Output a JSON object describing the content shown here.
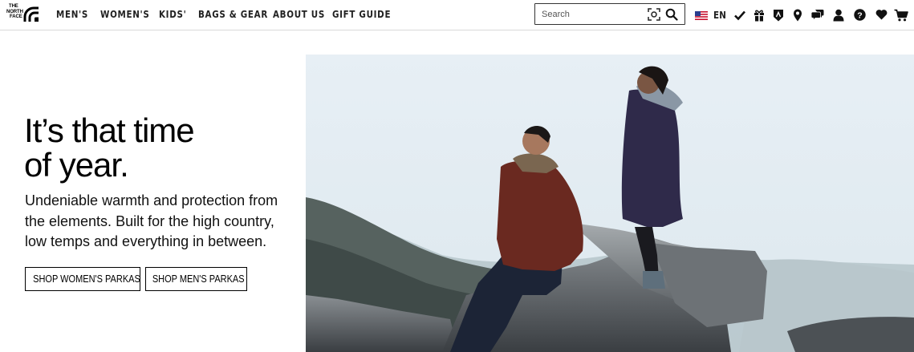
{
  "brand": {
    "logo_lines": [
      "THE",
      "NORTH",
      "FACE"
    ]
  },
  "nav": {
    "items": [
      {
        "label": "MEN'S"
      },
      {
        "label": "WOMEN'S"
      },
      {
        "label": "KIDS'"
      },
      {
        "label": "BAGS & GEAR"
      },
      {
        "label": "ABOUT US"
      },
      {
        "label": "GIFT GUIDE"
      }
    ]
  },
  "search": {
    "placeholder": "Search",
    "value": ""
  },
  "utility": {
    "language": "EN",
    "icons": [
      "us-flag-icon",
      "checkmark-icon",
      "gift-icon",
      "shield-badge-icon",
      "location-pin-icon",
      "chat-icon",
      "account-icon",
      "help-icon",
      "heart-icon",
      "cart-icon"
    ]
  },
  "hero": {
    "title": "It’s that time\nof year.",
    "body": "Undeniable warmth and protection from the elements. Built for the high country, low temps and everything in between.",
    "buttons": [
      {
        "label": "SHOP WOMEN'S PARKAS"
      },
      {
        "label": "SHOP MEN'S PARKAS"
      }
    ]
  },
  "colors": {
    "text": "#000000",
    "border": "#d9d9d9",
    "jacket_red": "#6e2a22",
    "jacket_navy": "#2f2a4a",
    "sky": "#e4edf3"
  }
}
